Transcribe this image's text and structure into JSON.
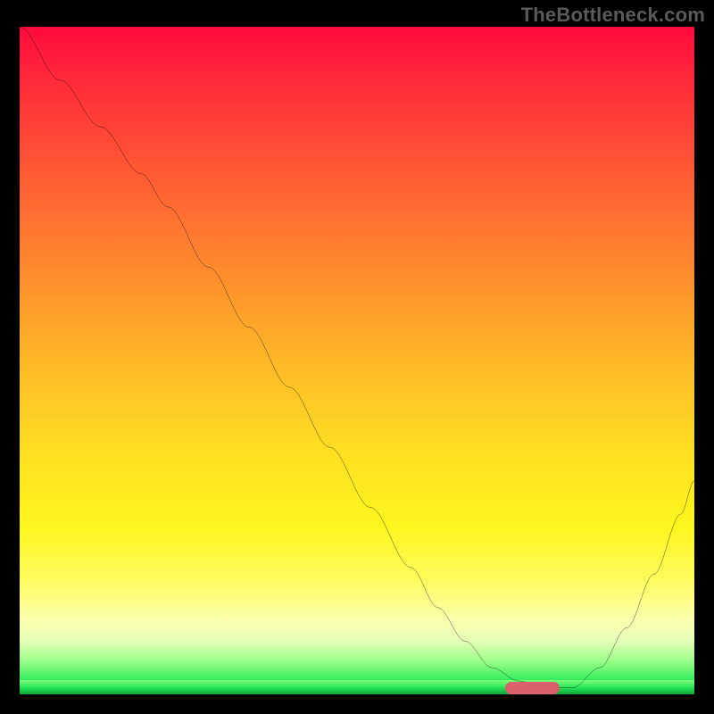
{
  "watermark": "TheBottleneck.com",
  "chart_data": {
    "type": "line",
    "title": "",
    "xlabel": "",
    "ylabel": "",
    "xlim": [
      0,
      100
    ],
    "ylim": [
      0,
      100
    ],
    "grid": false,
    "legend": false,
    "background": "gradient",
    "gradient_stops": [
      {
        "pos": 0,
        "color": "#ff0a3c"
      },
      {
        "pos": 22,
        "color": "#ff5a34"
      },
      {
        "pos": 50,
        "color": "#ffb828"
      },
      {
        "pos": 75,
        "color": "#fff61e"
      },
      {
        "pos": 92,
        "color": "#e6ffb8"
      },
      {
        "pos": 100,
        "color": "#0ac03e"
      }
    ],
    "series": [
      {
        "name": "bottleneck-curve",
        "x": [
          0,
          6,
          12,
          18,
          22,
          28,
          34,
          40,
          46,
          52,
          58,
          62,
          66,
          70,
          74,
          78,
          82,
          86,
          90,
          94,
          98,
          100
        ],
        "y": [
          100,
          92,
          85,
          78,
          73,
          64,
          55,
          46,
          37,
          28,
          19,
          13,
          8,
          4,
          2,
          1,
          1,
          4,
          10,
          18,
          27,
          32
        ]
      }
    ],
    "marker": {
      "name": "optimal-range",
      "shape": "pill",
      "x_center": 76,
      "width_x": 8,
      "y": 1,
      "color": "#d9616b"
    }
  },
  "colors": {
    "curve": "#000000",
    "marker": "#d9616b",
    "watermark": "#5a5a5a"
  }
}
